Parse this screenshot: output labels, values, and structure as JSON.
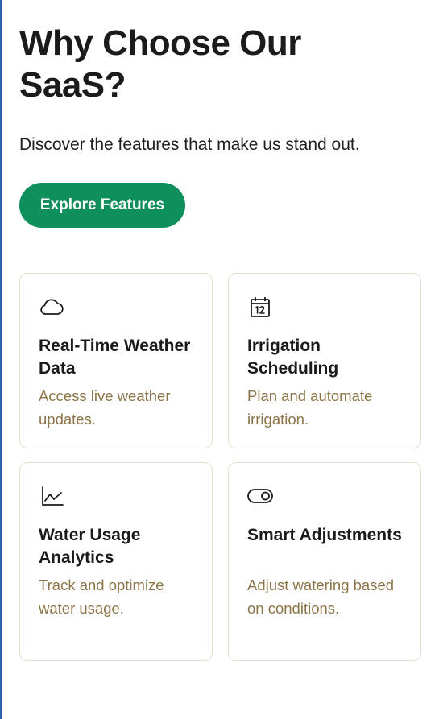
{
  "hero": {
    "title": "Why Choose Our SaaS?",
    "subtitle": "Discover the features that make us stand out.",
    "cta_label": "Explore Features"
  },
  "colors": {
    "accent": "#0f8f5c",
    "description_text": "#8c7448",
    "card_border": "#e7dfcd"
  },
  "features": [
    {
      "icon": "cloud-icon",
      "title": "Real-Time Weather Data",
      "description": "Access live weather updates."
    },
    {
      "icon": "calendar-icon",
      "title": "Irrigation Scheduling",
      "description": "Plan and automate irrigation."
    },
    {
      "icon": "line-chart-icon",
      "title": "Water Usage Analytics",
      "description": "Track and optimize water usage."
    },
    {
      "icon": "toggle-icon",
      "title": "Smart Adjustments",
      "description": "Adjust watering based on conditions."
    }
  ]
}
